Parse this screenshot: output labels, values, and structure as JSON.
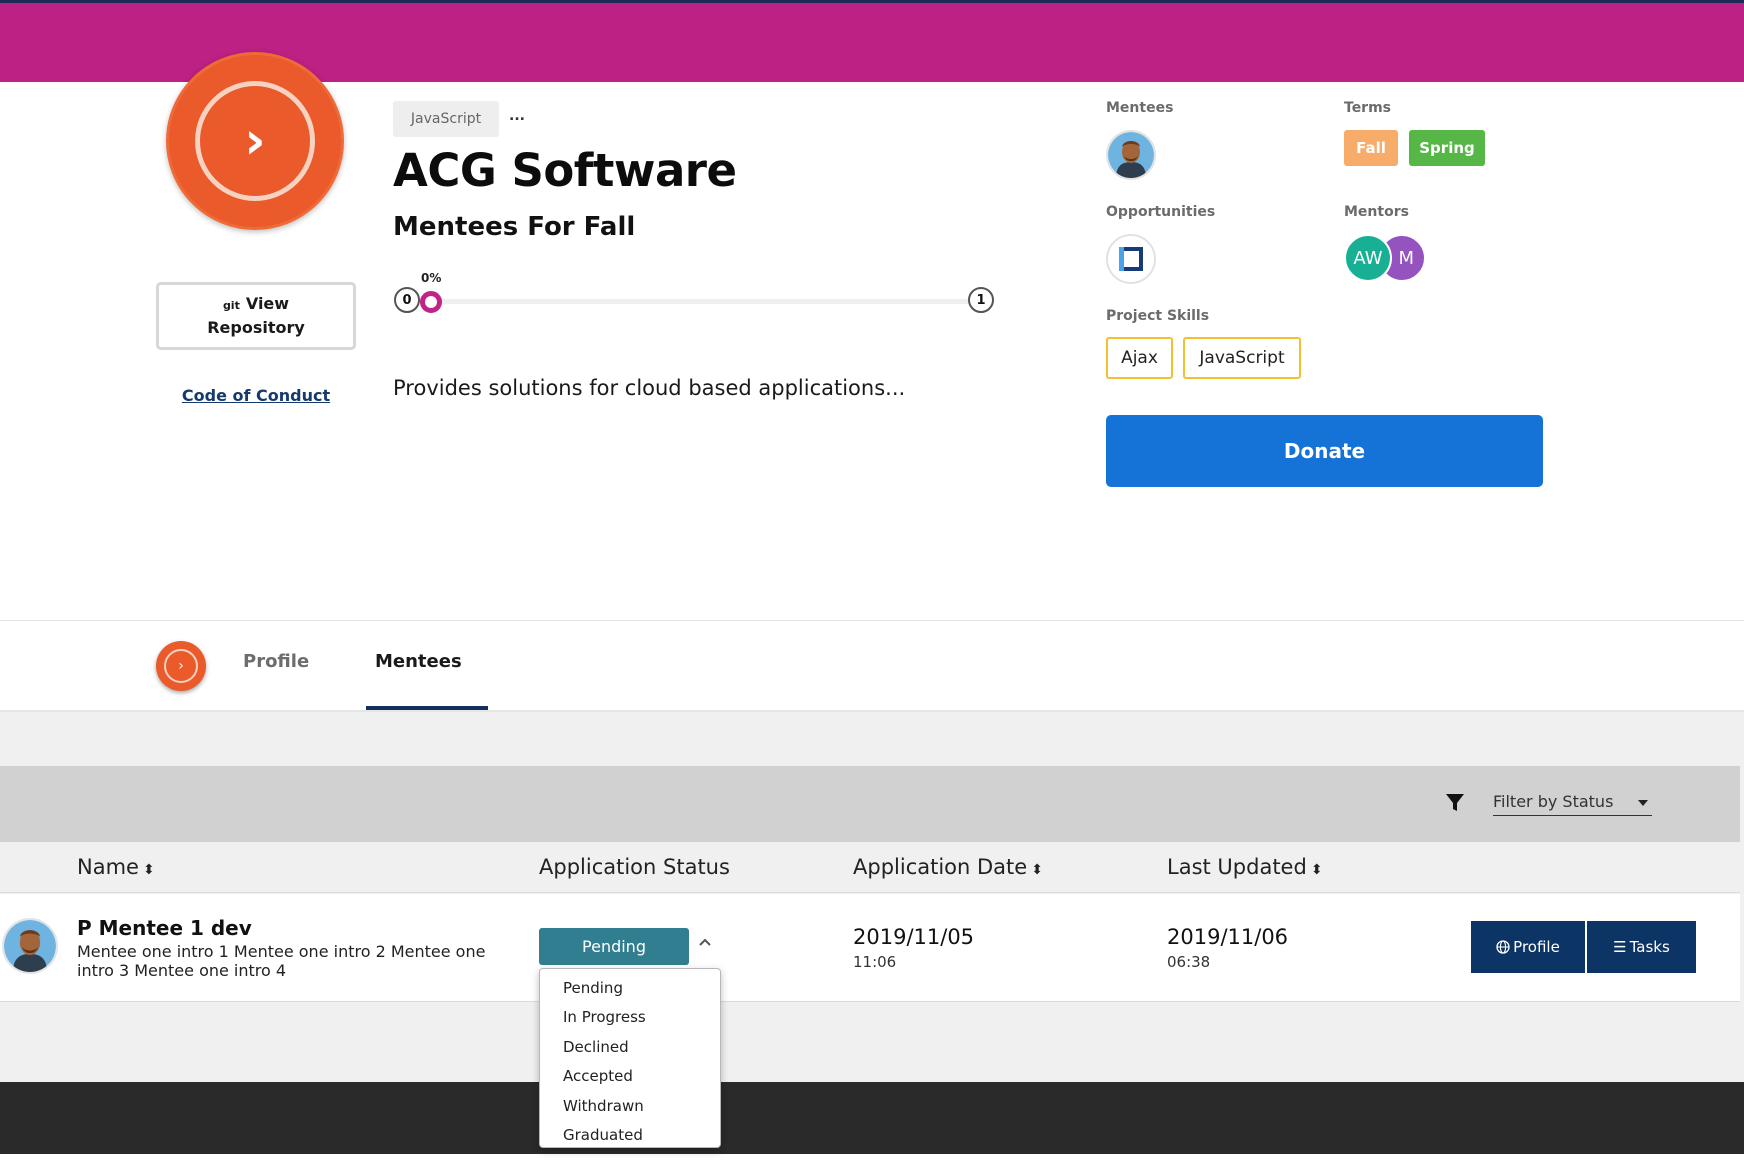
{
  "project": {
    "language_tag": "JavaScript",
    "more": "...",
    "title": "ACG Software",
    "subtitle": "Mentees For Fall",
    "progress": {
      "percent_label": "0%",
      "min": "0",
      "max": "1",
      "value": 0
    },
    "description": "Provides solutions for cloud based applications...",
    "view_repo_icon": "git",
    "view_repo_line1": "View",
    "view_repo_line2": "Repository",
    "code_of_conduct": "Code of Conduct"
  },
  "sidebar_info": {
    "mentees_label": "Mentees",
    "terms_label": "Terms",
    "terms": [
      {
        "label": "Fall",
        "color": "#f8ac6a"
      },
      {
        "label": "Spring",
        "color": "#56b747"
      }
    ],
    "opportunities_label": "Opportunities",
    "mentors_label": "Mentors",
    "mentors": [
      {
        "initials": "AW",
        "color": "#18b095"
      },
      {
        "initials": "M",
        "color": "#9553c0"
      }
    ],
    "skills_label": "Project Skills",
    "skills": [
      "Ajax",
      "JavaScript"
    ],
    "donate_label": "Donate"
  },
  "tabs": [
    {
      "label": "Profile",
      "active": false
    },
    {
      "label": "Mentees",
      "active": true
    }
  ],
  "filter": {
    "placeholder": "Filter by Status",
    "icon": "filter-icon"
  },
  "table": {
    "columns": {
      "name": "Name",
      "status": "Application Status",
      "date": "Application Date",
      "updated": "Last Updated"
    },
    "rows": [
      {
        "name": "P Mentee 1 dev",
        "intro": "Mentee one intro 1 Mentee one intro 2 Mentee one intro 3 Mentee one intro 4",
        "status": "Pending",
        "app_date": "2019/11/05",
        "app_time": "11:06",
        "updated_date": "2019/11/06",
        "updated_time": "06:38",
        "profile_label": "Profile",
        "tasks_label": "Tasks"
      }
    ]
  },
  "status_options": [
    "Pending",
    "In Progress",
    "Declined",
    "Accepted",
    "Withdrawn",
    "Graduated"
  ],
  "colors": {
    "brand_magenta": "#bc2183",
    "logo_orange": "#ea5a2a",
    "donate_blue": "#1572d6",
    "status_teal": "#317e91",
    "action_navy": "#0c3566"
  }
}
